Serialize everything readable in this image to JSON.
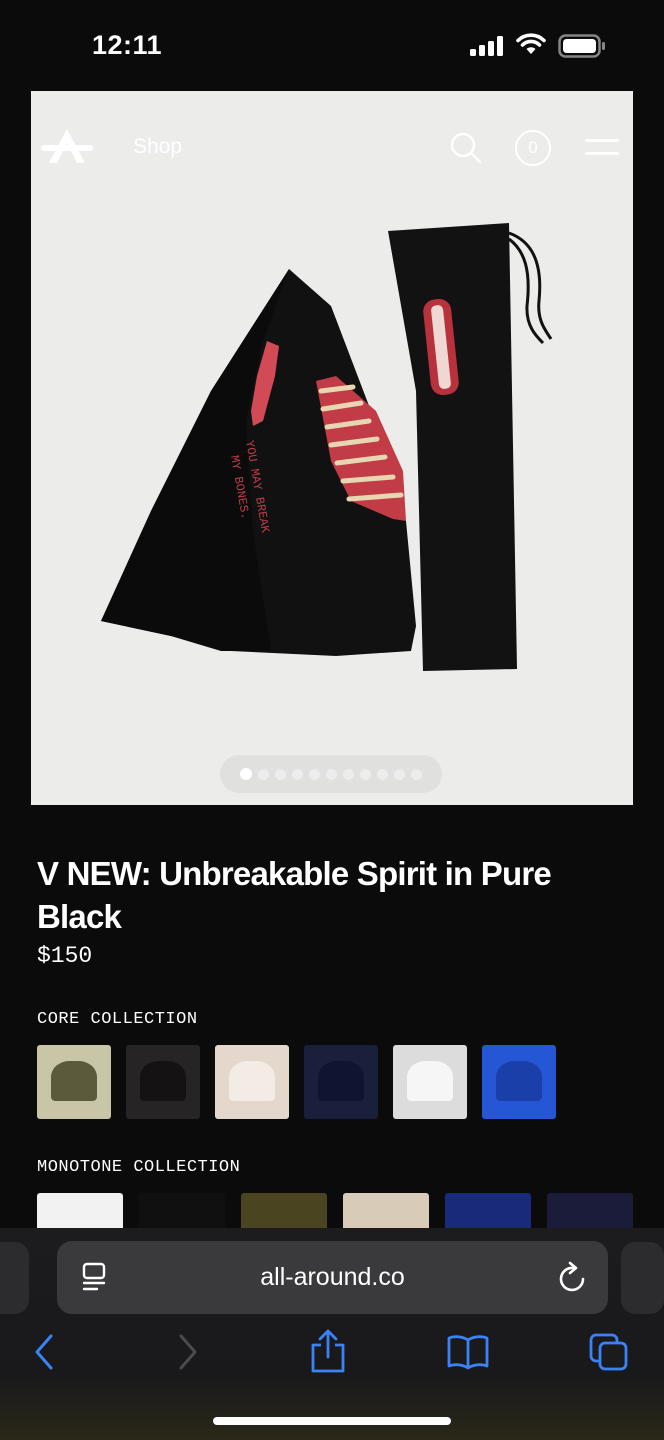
{
  "status_bar": {
    "time": "12:11"
  },
  "site_nav": {
    "shop_label": "Shop",
    "cart_count": "0"
  },
  "carousel": {
    "total_slides": 11,
    "active_index": 0
  },
  "product": {
    "title": "V NEW: Unbreakable Spirit in Pure Black",
    "price": "$150"
  },
  "collections": [
    {
      "label": "CORE COLLECTION",
      "swatches": [
        {
          "bg": "#c9c5a7",
          "color": "#5b5a3b"
        },
        {
          "bg": "#262424",
          "color": "#141212"
        },
        {
          "bg": "#e4d8cc",
          "color": "#f3ece4"
        },
        {
          "bg": "#1a1f3c",
          "color": "#0f1430"
        },
        {
          "bg": "#dcdcdc",
          "color": "#f6f6f6"
        },
        {
          "bg": "#2456d6",
          "color": "#1a3fa8"
        }
      ]
    },
    {
      "label": "MONOTONE COLLECTION",
      "swatches": [
        {
          "bg": "#f2f2f2",
          "color": "#e6e6e6"
        },
        {
          "bg": "#101010",
          "color": "#050505"
        },
        {
          "bg": "#4a4520",
          "color": "#3a3618"
        },
        {
          "bg": "#d8cbb8",
          "color": "#e9e0d2"
        },
        {
          "bg": "#1a2a7a",
          "color": "#1e3aa8"
        },
        {
          "bg": "#1a1c3a",
          "color": "#12142c"
        }
      ]
    }
  ],
  "browser": {
    "url": "all-around.co"
  },
  "colors": {
    "accent": "#3b82f6",
    "page_bg": "#0b0b0c"
  }
}
